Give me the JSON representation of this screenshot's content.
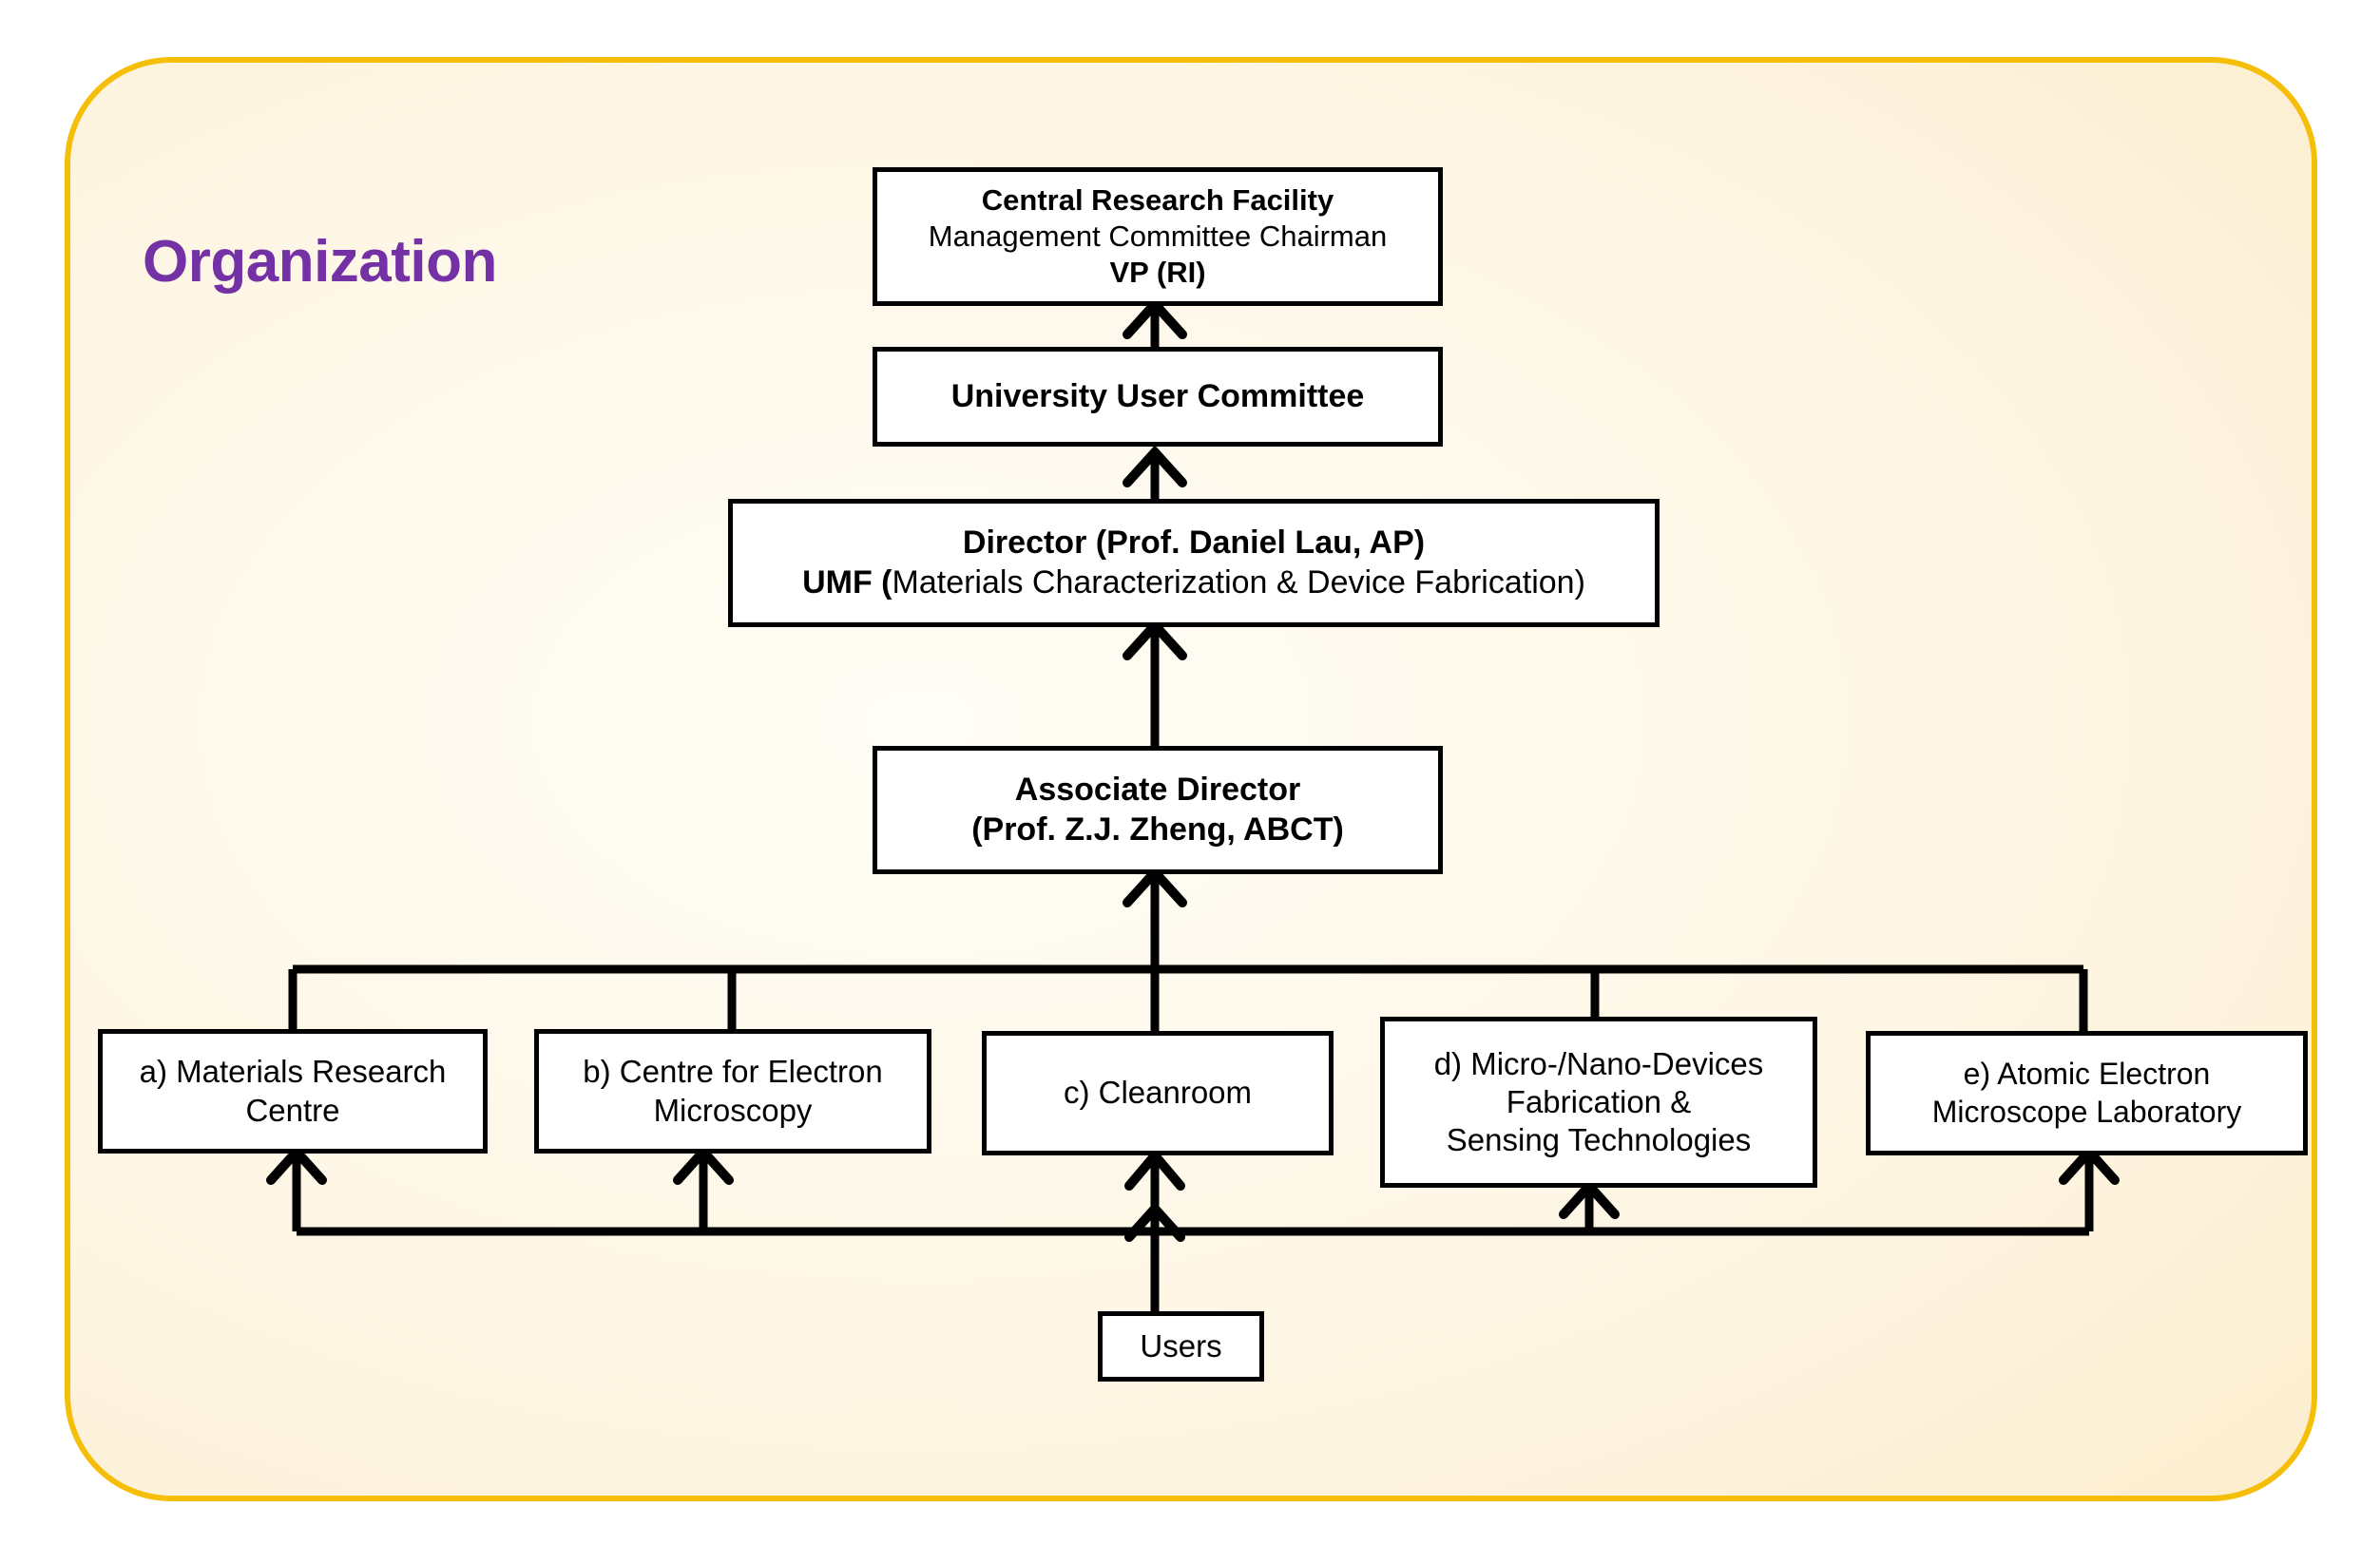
{
  "panel": {
    "title": "Organization",
    "title_color": "#7430A5",
    "border_color": "#F5BE08",
    "background_color": "#FDF4E0"
  },
  "nodes": {
    "central_research_facility": {
      "line1": "Central Research Facility",
      "line2": "Management Committee Chairman",
      "line3": "VP (RI)"
    },
    "university_user_committee": {
      "line1": "University User Committee"
    },
    "director": {
      "line1": "Director (Prof. Daniel Lau, AP)",
      "line2_bold": "UMF (",
      "line2_rest": "Materials Characterization & Device Fabrication)"
    },
    "associate_director": {
      "line1": "Associate Director",
      "line2": "(Prof. Z.J. Zheng, ABCT)"
    },
    "unit_a": {
      "line1": "a) Materials Research",
      "line2": "Centre"
    },
    "unit_b": {
      "line1": "b) Centre for Electron",
      "line2": "Microscopy"
    },
    "unit_c": {
      "line1": "c) Cleanroom"
    },
    "unit_d": {
      "line1": "d) Micro-/Nano-Devices",
      "line2": "Fabrication &",
      "line3": "Sensing Technologies"
    },
    "unit_e": {
      "line1": "e) Atomic Electron",
      "line2": "Microscope Laboratory"
    },
    "users": {
      "line1": "Users"
    }
  }
}
